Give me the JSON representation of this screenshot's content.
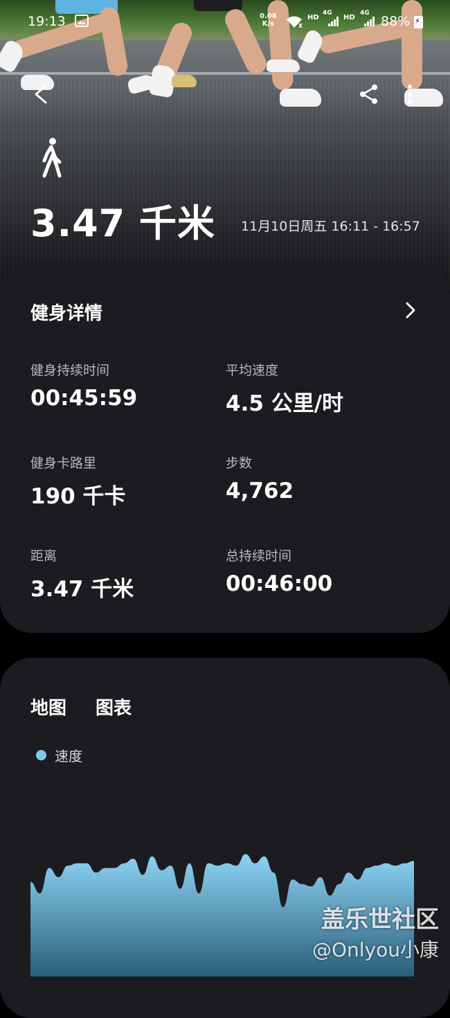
{
  "status_bar": {
    "time": "19:13",
    "net_speed_value": "0.08",
    "net_speed_unit": "K/s",
    "sim1_label": "HD",
    "sim1_tech": "4G",
    "sim2_label": "HD",
    "sim2_tech": "4G",
    "battery": "88%"
  },
  "header": {
    "activity_icon": "walk-icon",
    "distance": "3.47 千米",
    "date_range": "11月10日周五 16:11 - 16:57"
  },
  "details": {
    "title": "健身详情",
    "stats": [
      {
        "label": "健身持续时间",
        "value": "00:45:59"
      },
      {
        "label": "平均速度",
        "value": "4.5 公里/时"
      },
      {
        "label": "健身卡路里",
        "value": "190 千卡"
      },
      {
        "label": "步数",
        "value": "4,762"
      },
      {
        "label": "距离",
        "value": "3.47 千米"
      },
      {
        "label": "总持续时间",
        "value": "00:46:00"
      }
    ]
  },
  "chart_section": {
    "tabs": [
      "地图",
      "图表"
    ],
    "legend": "速度",
    "legend_color": "#7ec9f0"
  },
  "chart_data": {
    "type": "area",
    "series": [
      {
        "name": "速度",
        "values": [
          4.1,
          3.6,
          4.7,
          4.3,
          4.8,
          4.9,
          4.9,
          4.5,
          4.7,
          4.7,
          4.9,
          5.1,
          4.4,
          5.2,
          4.6,
          4.8,
          3.8,
          4.9,
          3.6,
          4.9,
          4.8,
          4.9,
          4.8,
          5.3,
          4.9,
          5.2,
          4.5,
          3.0,
          4.2,
          4.0,
          3.9,
          4.3,
          3.5,
          4.0,
          4.5,
          4.2,
          4.7,
          4.8,
          4.9,
          4.8,
          4.9,
          5.0
        ]
      }
    ],
    "grid": false
  },
  "watermark": {
    "line1": "盖乐世社区",
    "line2": "@Onlyou小康"
  }
}
